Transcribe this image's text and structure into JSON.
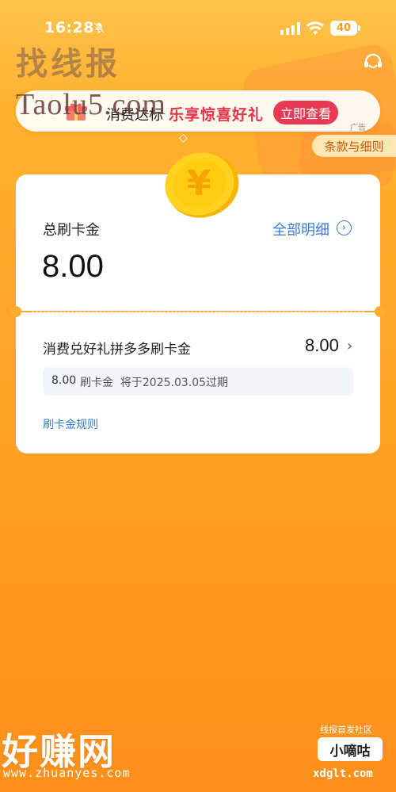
{
  "status_bar": {
    "time": "16:28",
    "battery": "40"
  },
  "watermarks": {
    "top_cn": "找线报",
    "top_site": "Taolu5.com",
    "bottom_big": "好赚网",
    "bottom_url": "www.zhuanyes.com",
    "community": "线报首发社区",
    "brand": "小嘀咕",
    "brand_url": "xdglt.com"
  },
  "banner": {
    "text_black": "消费达标",
    "text_red": "乐享惊喜好礼",
    "button": "立即查看",
    "ad_label": "广告"
  },
  "terms_button": "条款与细则",
  "coin_symbol": "¥",
  "card": {
    "total_label": "总刷卡金",
    "detail_link": "全部明细",
    "total_amount": "8.00",
    "item": {
      "title": "消费兑好礼拼多多刷卡金",
      "amount": "8.00",
      "expiry_amount": "8.00",
      "expiry_text": "刷卡金  将于2025.03.05过期"
    },
    "rules_link": "刷卡金规则"
  },
  "colors": {
    "accent_blue": "#3a7bd6",
    "banner_red": "#e83a55",
    "background_orange": "#ffa62a"
  },
  "icons": [
    "mute-icon",
    "signal-icon",
    "wifi-icon",
    "customer-service-icon",
    "gift-icon",
    "coin-icon",
    "chevron-right-icon"
  ]
}
